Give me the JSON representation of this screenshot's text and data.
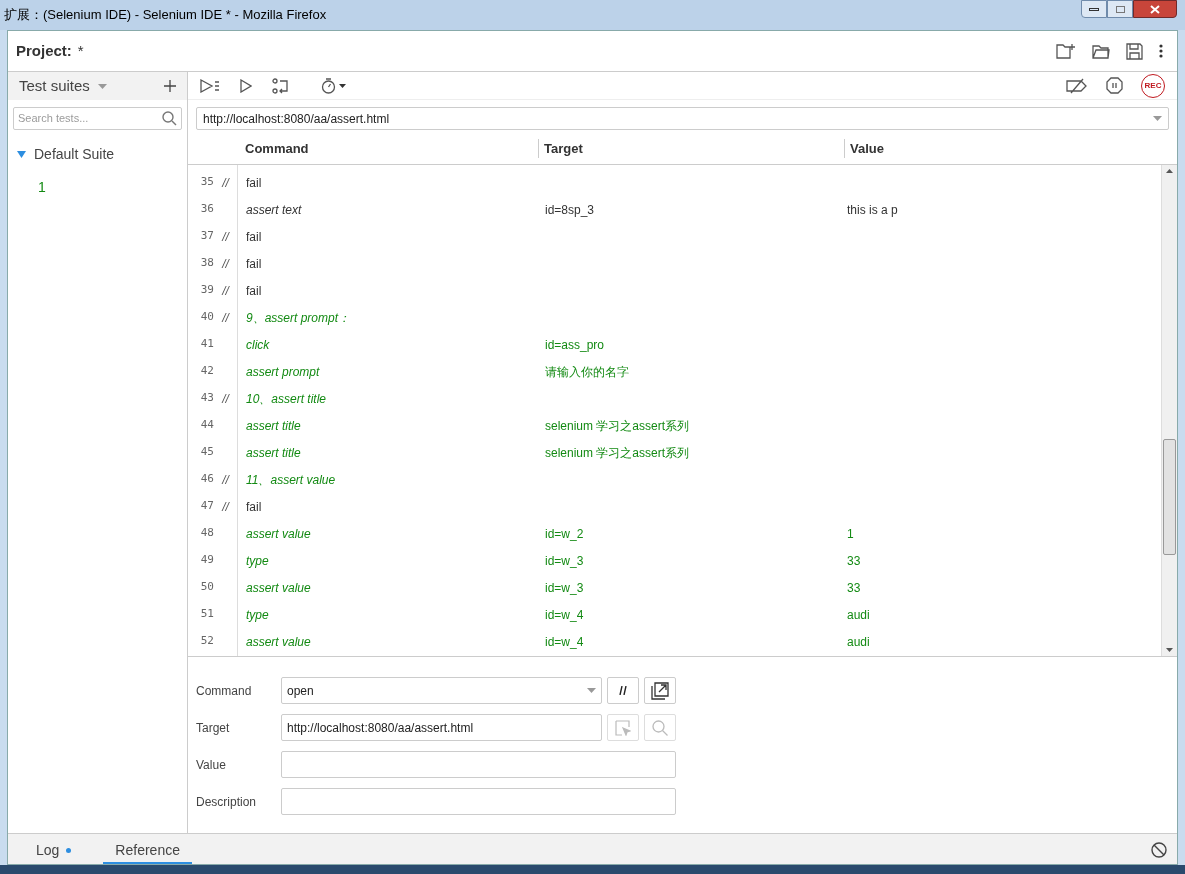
{
  "window": {
    "title": "扩展：(Selenium IDE) - Selenium IDE * - Mozilla Firefox"
  },
  "project": {
    "label": "Project:",
    "name": "*"
  },
  "sidebar": {
    "dropdown": "Test suites",
    "search": {
      "placeholder": "Search tests..."
    },
    "suites": [
      {
        "name": "Default Suite",
        "expanded": true,
        "children": [
          {
            "name": "1",
            "selected": false
          }
        ]
      }
    ]
  },
  "record_label": "REC",
  "url": "http://localhost:8080/aa/assert.html",
  "table": {
    "columns": [
      "Command",
      "Target",
      "Value"
    ],
    "rows": [
      {
        "number": "35",
        "marker": "//",
        "kind": "comment",
        "passed": false,
        "command": "fail",
        "target": "",
        "value": ""
      },
      {
        "number": "36",
        "kind": "command",
        "passed": false,
        "command": "assert text",
        "target": "id=8sp_3",
        "value": "this is a p"
      },
      {
        "number": "37",
        "marker": "//",
        "kind": "comment",
        "passed": false,
        "command": "fail",
        "target": "",
        "value": ""
      },
      {
        "number": "38",
        "marker": "//",
        "kind": "comment",
        "passed": false,
        "command": "fail",
        "target": "",
        "value": ""
      },
      {
        "number": "39",
        "marker": "//",
        "kind": "comment",
        "passed": false,
        "command": "fail",
        "target": "",
        "value": ""
      },
      {
        "number": "40",
        "marker": "//",
        "kind": "command",
        "passed": true,
        "command": "9、assert prompt：",
        "target": "",
        "value": ""
      },
      {
        "number": "41",
        "kind": "command",
        "passed": true,
        "command": "click",
        "target": "id=ass_pro",
        "value": ""
      },
      {
        "number": "42",
        "kind": "command",
        "passed": true,
        "command": "assert prompt",
        "target": "请输入你的名字",
        "value": ""
      },
      {
        "number": "43",
        "marker": "//",
        "kind": "command",
        "passed": true,
        "command": "10、assert title",
        "target": "",
        "value": ""
      },
      {
        "number": "44",
        "kind": "command",
        "passed": true,
        "command": "assert title",
        "target": "selenium 学习之assert系列",
        "value": ""
      },
      {
        "number": "45",
        "kind": "command",
        "passed": true,
        "command": "assert title",
        "target": "selenium 学习之assert系列",
        "value": ""
      },
      {
        "number": "46",
        "marker": "//",
        "kind": "command",
        "passed": true,
        "command": "11、assert value",
        "target": "",
        "value": ""
      },
      {
        "number": "47",
        "marker": "//",
        "kind": "comment",
        "passed": false,
        "command": "fail",
        "target": "",
        "value": ""
      },
      {
        "number": "48",
        "kind": "command",
        "passed": true,
        "command": "assert value",
        "target": "id=w_2",
        "value": "1"
      },
      {
        "number": "49",
        "kind": "command",
        "passed": true,
        "command": "type",
        "target": "id=w_3",
        "value": "33"
      },
      {
        "number": "50",
        "kind": "command",
        "passed": true,
        "command": "assert value",
        "target": "id=w_3",
        "value": "33"
      },
      {
        "number": "51",
        "kind": "command",
        "passed": true,
        "command": "type",
        "target": "id=w_4",
        "value": "audi"
      },
      {
        "number": "52",
        "kind": "command",
        "passed": true,
        "command": "assert value",
        "target": "id=w_4",
        "value": "audi"
      }
    ]
  },
  "editor": {
    "command": {
      "label": "Command",
      "value": "open"
    },
    "target": {
      "label": "Target",
      "value": "http://localhost:8080/aa/assert.html"
    },
    "value": {
      "label": "Value"
    },
    "description": {
      "label": "Description"
    }
  },
  "bottom_tabs": [
    {
      "label": "Log",
      "selected": false,
      "unread": true
    },
    {
      "label": "Reference",
      "selected": true,
      "unread": false
    }
  ]
}
